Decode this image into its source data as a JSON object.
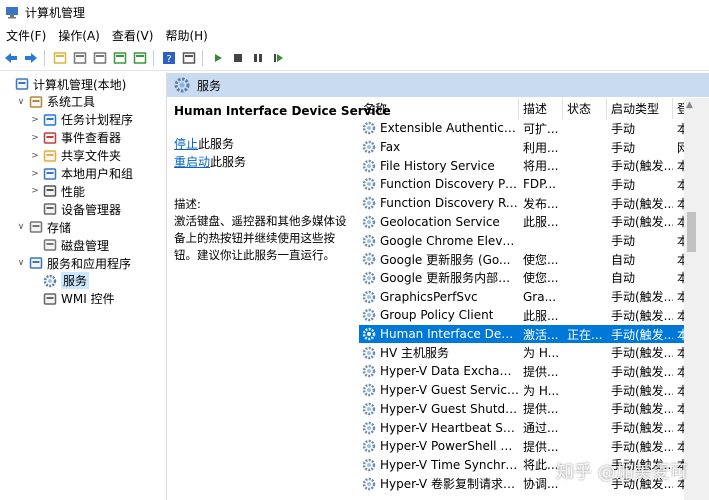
{
  "window": {
    "title": "计算机管理"
  },
  "menu": [
    "文件(F)",
    "操作(A)",
    "查看(V)",
    "帮助(H)"
  ],
  "toolbar": [
    "back-icon",
    "forward-icon",
    "up-folder-icon",
    "console-tree-icon",
    "properties-icon",
    "refresh-icon",
    "export-icon",
    "help-icon",
    "show-hide-icon",
    "start-icon",
    "stop-icon",
    "pause-icon",
    "restart-icon"
  ],
  "tree": [
    {
      "label": "计算机管理(本地)",
      "icon": "computer-management-icon",
      "level": 0,
      "exp": ""
    },
    {
      "label": "系统工具",
      "icon": "tools-icon",
      "level": 1,
      "exp": "∨"
    },
    {
      "label": "任务计划程序",
      "icon": "clock-icon",
      "level": 2,
      "exp": ">"
    },
    {
      "label": "事件查看器",
      "icon": "event-viewer-icon",
      "level": 2,
      "exp": ">"
    },
    {
      "label": "共享文件夹",
      "icon": "shared-folder-icon",
      "level": 2,
      "exp": ">"
    },
    {
      "label": "本地用户和组",
      "icon": "users-icon",
      "level": 2,
      "exp": ">"
    },
    {
      "label": "性能",
      "icon": "performance-icon",
      "level": 2,
      "exp": ">"
    },
    {
      "label": "设备管理器",
      "icon": "device-manager-icon",
      "level": 2,
      "exp": ""
    },
    {
      "label": "存储",
      "icon": "storage-icon",
      "level": 1,
      "exp": "∨"
    },
    {
      "label": "磁盘管理",
      "icon": "disk-icon",
      "level": 2,
      "exp": ""
    },
    {
      "label": "服务和应用程序",
      "icon": "services-apps-icon",
      "level": 1,
      "exp": "∨"
    },
    {
      "label": "服务",
      "icon": "gear-icon",
      "level": 2,
      "exp": "",
      "selected": true
    },
    {
      "label": "WMI 控件",
      "icon": "wmi-icon",
      "level": 2,
      "exp": ""
    }
  ],
  "header": {
    "label": "服务"
  },
  "details": {
    "title": "Human Interface Device Service",
    "stop_prefix": "停止",
    "stop_suffix": "此服务",
    "restart_prefix": "重启动",
    "restart_suffix": "此服务",
    "desc_label": "描述:",
    "description": "激活键盘、遥控器和其他多媒体设备上的热按钮并继续使用这些按钮。建议你让此服务一直运行。"
  },
  "columns": {
    "name": "名称",
    "desc": "描述",
    "status": "状态",
    "startup": "启动类型",
    "login": "登"
  },
  "rows": [
    {
      "name": "Extensible Authentication...",
      "desc": "可扩...",
      "status": "",
      "startup": "手动",
      "login": "本"
    },
    {
      "name": "Fax",
      "desc": "利用...",
      "status": "",
      "startup": "手动",
      "login": "网"
    },
    {
      "name": "File History Service",
      "desc": "将用...",
      "status": "",
      "startup": "手动(触发...",
      "login": "本"
    },
    {
      "name": "Function Discovery Provi...",
      "desc": "FDP...",
      "status": "",
      "startup": "手动",
      "login": "本"
    },
    {
      "name": "Function Discovery Reso...",
      "desc": "发布...",
      "status": "",
      "startup": "手动(触发...",
      "login": "本"
    },
    {
      "name": "Geolocation Service",
      "desc": "此服...",
      "status": "",
      "startup": "手动(触发...",
      "login": "本"
    },
    {
      "name": "Google Chrome Elevatio...",
      "desc": "",
      "status": "",
      "startup": "手动",
      "login": "本"
    },
    {
      "name": "Google 更新服务 (Go...",
      "desc": "使您...",
      "status": "",
      "startup": "自动",
      "login": "本"
    },
    {
      "name": "Google 更新服务内部服务",
      "desc": "使您...",
      "status": "",
      "startup": "自动",
      "login": "本"
    },
    {
      "name": "GraphicsPerfSvc",
      "desc": "Gra...",
      "status": "",
      "startup": "手动(触发...",
      "login": "本"
    },
    {
      "name": "Group Policy Client",
      "desc": "此服...",
      "status": "",
      "startup": "手动(触发...",
      "login": "本"
    },
    {
      "name": "Human Interface Device ...",
      "desc": "激活...",
      "status": "正在...",
      "startup": "手动(触发...",
      "login": "本",
      "selected": true
    },
    {
      "name": "HV 主机服务",
      "desc": "为 H...",
      "status": "",
      "startup": "手动(触发...",
      "login": "本"
    },
    {
      "name": "Hyper-V Data Exchange ...",
      "desc": "提供...",
      "status": "",
      "startup": "手动(触发...",
      "login": "本"
    },
    {
      "name": "Hyper-V Guest Service In...",
      "desc": "为 H...",
      "status": "",
      "startup": "手动(触发...",
      "login": "本"
    },
    {
      "name": "Hyper-V Guest Shutdown...",
      "desc": "提供...",
      "status": "",
      "startup": "手动(触发...",
      "login": "本"
    },
    {
      "name": "Hyper-V Heartbeat Service",
      "desc": "通过...",
      "status": "",
      "startup": "手动(触发...",
      "login": "本"
    },
    {
      "name": "Hyper-V PowerShell Dire...",
      "desc": "提供...",
      "status": "",
      "startup": "手动(触发...",
      "login": "本"
    },
    {
      "name": "Hyper-V Time Synchroniz...",
      "desc": "将此...",
      "status": "",
      "startup": "手动(触发...",
      "login": "本"
    },
    {
      "name": "Hyper-V 卷影复制请求程序",
      "desc": "协调...",
      "status": "",
      "startup": "手动(触发...",
      "login": "本"
    }
  ],
  "watermark": "知乎 @加美麦可"
}
